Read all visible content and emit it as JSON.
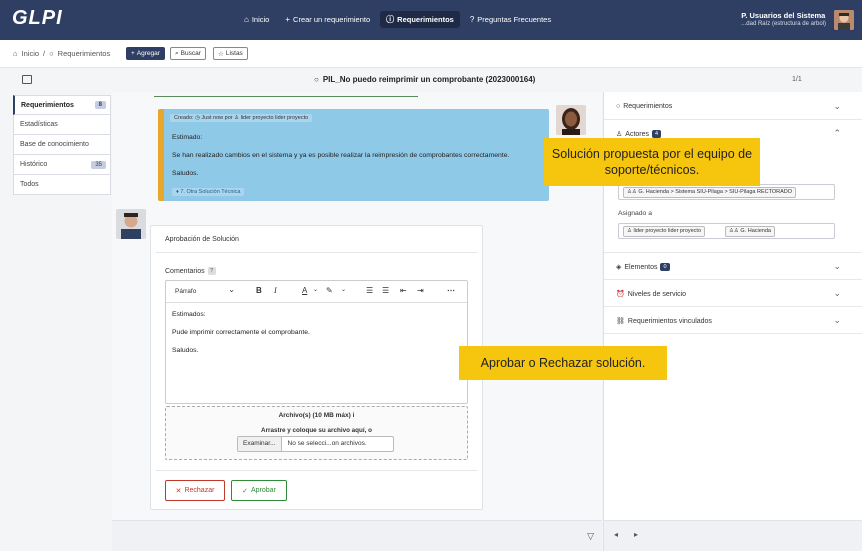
{
  "app": {
    "logo": "GLPI",
    "nav": [
      {
        "icon": "⌂",
        "icon_name": "home-icon",
        "label": "Inicio"
      },
      {
        "icon": "+",
        "icon_name": "plus-icon",
        "label": "Crear un requerimiento"
      },
      {
        "icon": "ⓘ",
        "icon_name": "alert-circle-icon",
        "label": "Requerimientos"
      },
      {
        "icon": "?",
        "icon_name": "help-icon",
        "label": "Preguntas Frecuentes"
      }
    ],
    "user": {
      "name": "P. Usuarios del Sistema",
      "entity": "...dad Raíz (estructura de arbol)"
    }
  },
  "breadcrumb": {
    "home": "Inicio",
    "sep": "/",
    "current": "Requerimientos"
  },
  "toolbar": {
    "add": "Agregar",
    "search": "Buscar",
    "lists": "Listas"
  },
  "ticket": {
    "title": "PIL_No puedo reimprimir un comprobante (2023000164)",
    "pager": "1/1"
  },
  "sidebar": {
    "items": [
      {
        "label": "Requerimientos",
        "badge": "8"
      },
      {
        "label": "Estadísticas",
        "badge": ""
      },
      {
        "label": "Base de conocimiento",
        "badge": ""
      },
      {
        "label": "Histórico",
        "badge": "35"
      },
      {
        "label": "Todos",
        "badge": ""
      }
    ]
  },
  "solution": {
    "meta": "Creado: ◷ Just now por  ♙ lider proyecto lider proyecto",
    "lines": [
      "Estimado:",
      "Se han realizado cambios en el sistema y ya es posible realizar la reimpresión de comprobantes correctamente.",
      "Saludos."
    ],
    "tag": "♦ 7. Otra Solución Técnica"
  },
  "approval": {
    "title": "Aprobación de Solución",
    "comments_label": "Comentarios",
    "help": "?",
    "editor_format": "Párrafo",
    "editor_lines": [
      "Estimados:",
      "Pude imprimir correctamente el comprobante.",
      "Saludos."
    ],
    "files_label": "Archivo(s) (10 MB máx)",
    "files_info": "i",
    "drop_text": "Arrastre y coloque su archivo aquí, o",
    "browse": "Examinar...",
    "no_file": "No se selecci...on archivos.",
    "reject": "Rechazar",
    "approve": "Aprobar"
  },
  "right_panel": {
    "sections": [
      {
        "label": "Requerimientos",
        "icon_name": "alert-circle-icon",
        "badge": ""
      },
      {
        "label": "Actores",
        "icon_name": "users-icon",
        "badge": "4"
      },
      {
        "label": "Elementos",
        "icon_name": "package-icon",
        "badge": "0"
      },
      {
        "label": "Niveles de servicio",
        "icon_name": "alarm-icon",
        "badge": ""
      },
      {
        "label": "Requerimientos vinculados",
        "icon_name": "link-icon",
        "badge": ""
      }
    ],
    "observer_tag": "♙♙ G. Hacienda > Sistema SIU-Pilaga > SIU-Pilaga RECTORADO",
    "assigned_label": "Asignado a",
    "assigned_tags": [
      "♙ lider proyecto lider proyecto",
      "♙♙ G. Hacienda"
    ]
  },
  "callouts": {
    "solution_note": "Solución propuesta por el equipo de soporte/técnicos.",
    "approve_note": "Aprobar o Rechazar solución."
  }
}
